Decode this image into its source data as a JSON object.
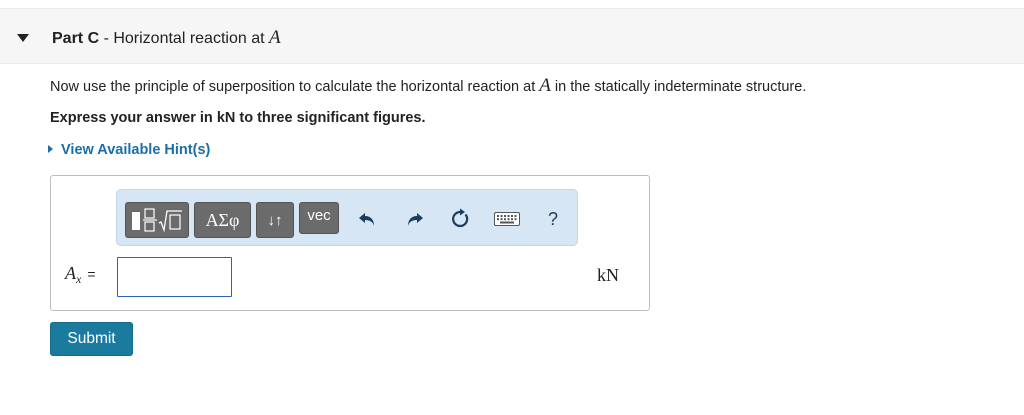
{
  "part": {
    "label": "Part C",
    "separator": " - ",
    "title": "Horizontal reaction at ",
    "title_var": "A"
  },
  "question": {
    "text_before": "Now use the principle of superposition to calculate the horizontal reaction at ",
    "text_var": "A",
    "text_after": " in the statically indeterminate structure."
  },
  "instruction": "Express your answer in kN to three significant figures.",
  "hint_link": "View Available Hint(s)",
  "toolbar": {
    "greek_label": "ΑΣφ",
    "arrows_label": "↓↑",
    "vec_label": "vec",
    "help_label": "?"
  },
  "answer": {
    "var_symbol": "A",
    "var_subscript": "x",
    "equals": "=",
    "value": "",
    "unit": "kN"
  },
  "submit_label": "Submit",
  "colors": {
    "link": "#1b6ea8",
    "submit": "#1a7b9f",
    "toolbar_bg": "#d6e6f5",
    "input_border": "#2a64b8"
  }
}
